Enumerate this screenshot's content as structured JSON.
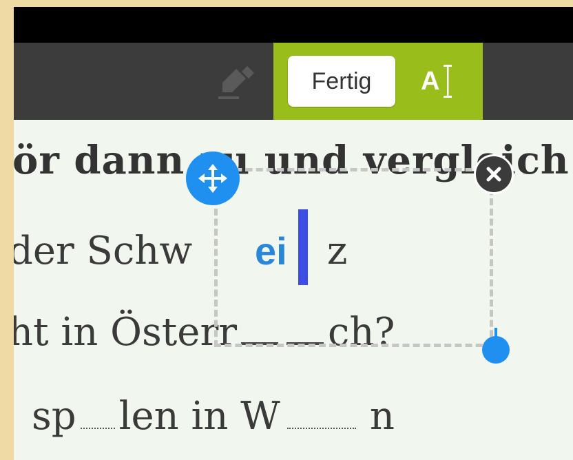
{
  "toolbar": {
    "done_label": "Fertig",
    "text_tool_label": "A",
    "pencil_icon": "pencil-icon",
    "text_cursor_icon": "text-cursor-icon",
    "accent_color": "#99be1c",
    "bar_color": "#3c3c3c"
  },
  "exercise": {
    "line1": "ör dann zu und vergleich",
    "line2_prefix": "der  Schw",
    "line2_typed": "ei",
    "line2_suffix": "z",
    "line3_prefix": "ht  in  Österr",
    "line3_suffix": "ch?",
    "line4_a": "sp",
    "line4_b": "len  in  W",
    "line4_c": "n"
  },
  "handles": {
    "move_icon": "move-arrows-icon",
    "close_icon": "close-icon",
    "resize_icon": "resize-handle-icon",
    "handle_color": "#1f8ff0"
  }
}
